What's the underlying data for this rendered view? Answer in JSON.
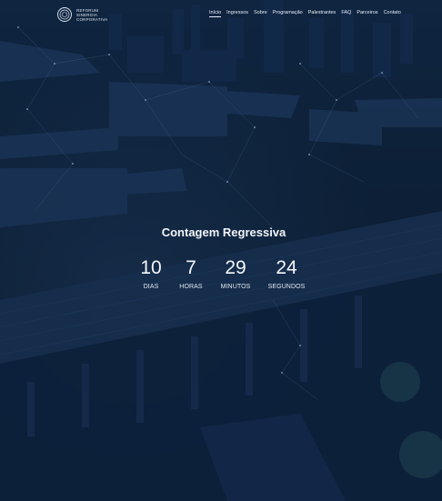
{
  "header": {
    "logo": {
      "line1": "REFORUM",
      "line2": "SINERGIA",
      "line3": "CORPORATIVA"
    },
    "nav": [
      {
        "label": "Início",
        "active": true
      },
      {
        "label": "Ingressos"
      },
      {
        "label": "Sobre"
      },
      {
        "label": "Programação"
      },
      {
        "label": "Palestrantes"
      },
      {
        "label": "FAQ"
      },
      {
        "label": "Parceiros"
      },
      {
        "label": "Contato"
      }
    ]
  },
  "countdown": {
    "title": "Contagem Regressiva",
    "units": [
      {
        "value": "10",
        "label": "DIAS"
      },
      {
        "value": "7",
        "label": "HORAS"
      },
      {
        "value": "29",
        "label": "MINUTOS"
      },
      {
        "value": "24",
        "label": "SEGUNDOS"
      }
    ]
  },
  "colors": {
    "overlay": "#0c1f36",
    "text": "#ffffff"
  }
}
